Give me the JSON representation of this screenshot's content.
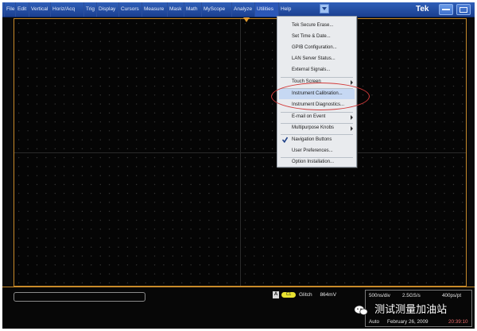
{
  "menubar": {
    "items": [
      "File",
      "Edit",
      "Vertical",
      "Horiz/Acq",
      "Trig",
      "Display",
      "Cursors",
      "Measure",
      "Mask",
      "Math",
      "MyScope",
      "Analyze",
      "Utilities",
      "Help"
    ],
    "brand": "Tek"
  },
  "utilities_menu": {
    "items": [
      {
        "label": "Tek Secure Erase...",
        "submenu": false,
        "checked": false
      },
      {
        "label": "Set Time & Date...",
        "submenu": false,
        "checked": false
      },
      {
        "label": "GPIB Configuration...",
        "submenu": false,
        "checked": false
      },
      {
        "label": "LAN Server Status...",
        "submenu": false,
        "checked": false
      },
      {
        "label": "External Signals...",
        "submenu": false,
        "checked": false
      },
      {
        "label": "Touch Screen",
        "submenu": true,
        "checked": false
      },
      {
        "label": "Instrument Calibration...",
        "submenu": false,
        "checked": false
      },
      {
        "label": "Instrument Diagnostics...",
        "submenu": false,
        "checked": false
      },
      {
        "label": "E-mail on Event",
        "submenu": true,
        "checked": false
      },
      {
        "label": "Multipurpose Knobs",
        "submenu": true,
        "checked": false
      },
      {
        "label": "Navigation Buttons",
        "submenu": false,
        "checked": true
      },
      {
        "label": "User Preferences...",
        "submenu": false,
        "checked": false
      },
      {
        "label": "Option Installation...",
        "submenu": false,
        "checked": false
      }
    ]
  },
  "trigger_readout": {
    "source_badge": "A",
    "channel": "C1",
    "type": "Glitch",
    "level": "864mV"
  },
  "acq_readout": {
    "timebase": "500ns/div",
    "sample_rate": "2.5GS/s",
    "resolution": "400ps/pt",
    "mode": "Auto",
    "date": "February 26, 2009",
    "time": "20:39:10"
  },
  "watermark": "测试测量加油站",
  "colors": {
    "menubar": "#1b3f8f",
    "graticule_border": "#c88a2a",
    "highlight_ellipse": "#d23a3a",
    "time_text": "#ee6b6b"
  }
}
